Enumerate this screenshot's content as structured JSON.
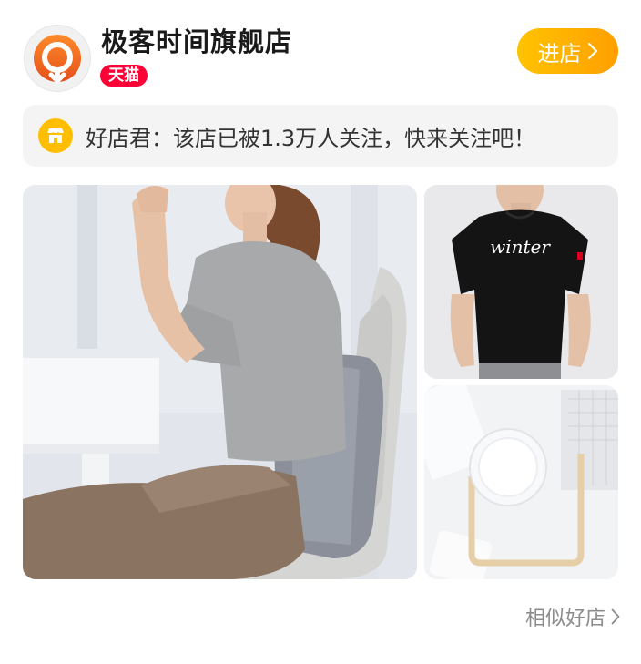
{
  "shop": {
    "name": "极客时间旗舰店",
    "badge": "天猫",
    "enter_label": "进店"
  },
  "notice": {
    "icon": "shop-icon",
    "text": "好店君：该店已被1.3万人关注，快来关注吧！"
  },
  "products": [
    {
      "icon": "lumbar-cushion-photo"
    },
    {
      "icon": "tshirt-photo",
      "print_text": "winter"
    },
    {
      "icon": "lamp-photo"
    }
  ],
  "footer": {
    "similar_label": "相似好店"
  },
  "colors": {
    "accent": "#ffb400",
    "tmall_red": "#ff0036",
    "logo_orange": "#f2671d"
  }
}
